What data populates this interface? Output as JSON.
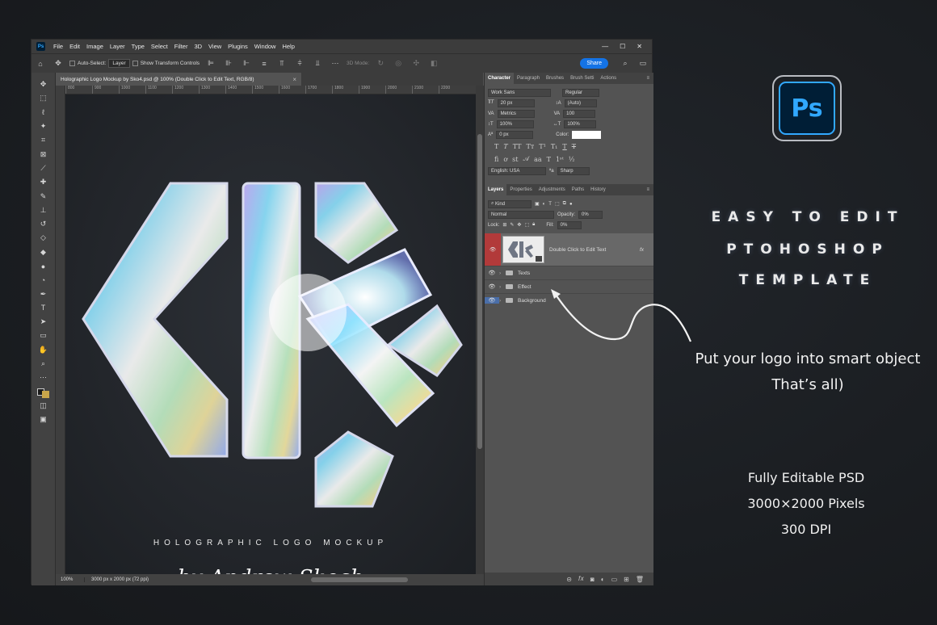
{
  "menubar": {
    "app_icon": "Ps",
    "items": [
      "File",
      "Edit",
      "Image",
      "Layer",
      "Type",
      "Select",
      "Filter",
      "3D",
      "View",
      "Plugins",
      "Window",
      "Help"
    ],
    "window_controls": [
      "—",
      "☐",
      "✕"
    ]
  },
  "options": {
    "auto_select": "Auto-Select:",
    "layer_dropdown": "Layer",
    "show_transform": "Show Transform Controls",
    "mode_3d": "3D Mode:",
    "share": "Share"
  },
  "document": {
    "tab_title": "Holographic Logo Mockup by Sko4.psd @ 100% (Double Click to Edit Text, RGB/8)",
    "tab_close": "×",
    "ruler_ticks": [
      "800",
      "900",
      "1000",
      "1100",
      "1200",
      "1300",
      "1400",
      "1500",
      "1600",
      "1700",
      "1800",
      "1900",
      "2000",
      "2100",
      "2200"
    ],
    "zoom": "100%",
    "dimensions": "3000 px x 2000 px (72 ppi)",
    "mockup_title": "HOLOGRAPHIC LOGO MOCKUP",
    "mockup_signature": "by Andrew Skoch"
  },
  "character_panel": {
    "tabs": [
      "Character",
      "Paragraph",
      "Brushes",
      "Brush Setti",
      "Actions"
    ],
    "font_family": "Work Sans",
    "font_style": "Regular",
    "font_size": "20 px",
    "leading": "(Auto)",
    "kerning": "Metrics",
    "tracking": "100",
    "vertical_scale": "100%",
    "horizontal_scale": "100%",
    "baseline_shift": "0 px",
    "color_label": "Color:",
    "color": "#ffffff",
    "language": "English: USA",
    "antialias": "Sharp"
  },
  "layers_panel": {
    "tabs": [
      "Layers",
      "Properties",
      "Adjustments",
      "Paths",
      "History"
    ],
    "filter_kind": "Kind",
    "blend_mode": "Normal",
    "opacity_label": "Opacity:",
    "opacity": "0%",
    "lock_label": "Lock:",
    "fill_label": "Fill:",
    "fill": "0%",
    "smart_layer_name": "Double Click to Edit Text",
    "fx": "fx",
    "groups": [
      "Texts",
      "Effect",
      "Background"
    ]
  },
  "marketing": {
    "badge": "Ps",
    "headline": [
      "EASY TO EDIT",
      "PTOHOSHOP",
      "TEMPLATE"
    ],
    "caption": [
      "Put your logo into smart object",
      "That’s all)"
    ],
    "features": [
      "Fully Editable PSD",
      "3000×2000 Pixels",
      "300 DPI"
    ]
  }
}
